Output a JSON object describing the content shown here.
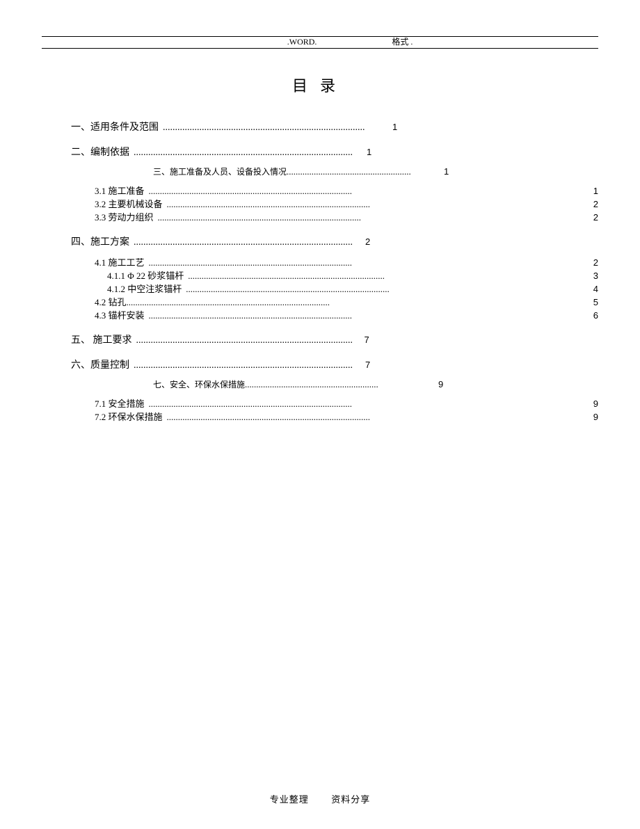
{
  "header": {
    "left": ".WORD.",
    "right": "格式 ."
  },
  "title": "目录",
  "toc": [
    {
      "label": "一、适用条件及范围",
      "page": "1"
    },
    {
      "label": "二、编制依据",
      "page": "1"
    },
    {
      "label": "三、施工准备及人员、设备投入情况",
      "page": "1"
    },
    {
      "label": "3.1 施工准备",
      "page": "1"
    },
    {
      "label": "3.2 主要机械设备",
      "page": "2"
    },
    {
      "label": "3.3 劳动力组织",
      "page": "2"
    },
    {
      "label": "四、施工方案",
      "page": "2"
    },
    {
      "label": "4.1 施工工艺",
      "page": "2"
    },
    {
      "label": "4.1.1 Φ 22 砂浆锚杆",
      "page": "3"
    },
    {
      "label": "4.1.2 中空注浆锚杆",
      "page": "4"
    },
    {
      "label": "4.2 钻孔",
      "page": "5"
    },
    {
      "label": "4.3 锚杆安装",
      "page": "6"
    },
    {
      "label": "五、 施工要求",
      "page": "7"
    },
    {
      "label": "六、质量控制",
      "page": "7"
    },
    {
      "label": "七、安全、环保水保措施",
      "page": "9"
    },
    {
      "label": "7.1 安全措施",
      "page": "9"
    },
    {
      "label": "7.2 环保水保措施",
      "page": "9"
    }
  ],
  "footer": {
    "left": "专业整理",
    "right": "资料分享"
  }
}
